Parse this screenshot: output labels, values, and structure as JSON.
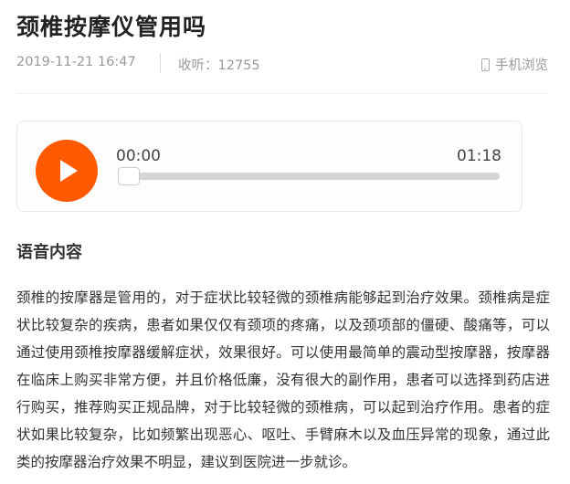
{
  "article": {
    "title": "颈椎按摩仪管用吗",
    "date": "2019-11-21 16:47",
    "views": "收听：12755",
    "mobile_label": "手机浏览"
  },
  "player": {
    "current_time": "00:00",
    "total_time": "01:18",
    "progress": 0,
    "accent_color": "#ff5a00"
  },
  "section": {
    "title": "语音内容",
    "body": "颈椎的按摩器是管用的，对于症状比较轻微的颈椎病能够起到治疗效果。颈椎病是症状比较复杂的疾病，患者如果仅仅有颈项的疼痛，以及颈项部的僵硬、酸痛等，可以通过使用颈椎按摩器缓解症状，效果很好。可以使用最简单的震动型按摩器，按摩器在临床上购买非常方便，并且价格低廉，没有很大的副作用，患者可以选择到药店进行购买，推荐购买正规品牌，对于比较轻微的颈椎病，可以起到治疗作用。患者的症状如果比较复杂，比如频繁出现恶心、呕吐、手臂麻木以及血压异常的现象，通过此类的按摩器治疗效果不明显，建议到医院进一步就诊。"
  },
  "icons": [
    "play-icon",
    "phone-icon"
  ]
}
